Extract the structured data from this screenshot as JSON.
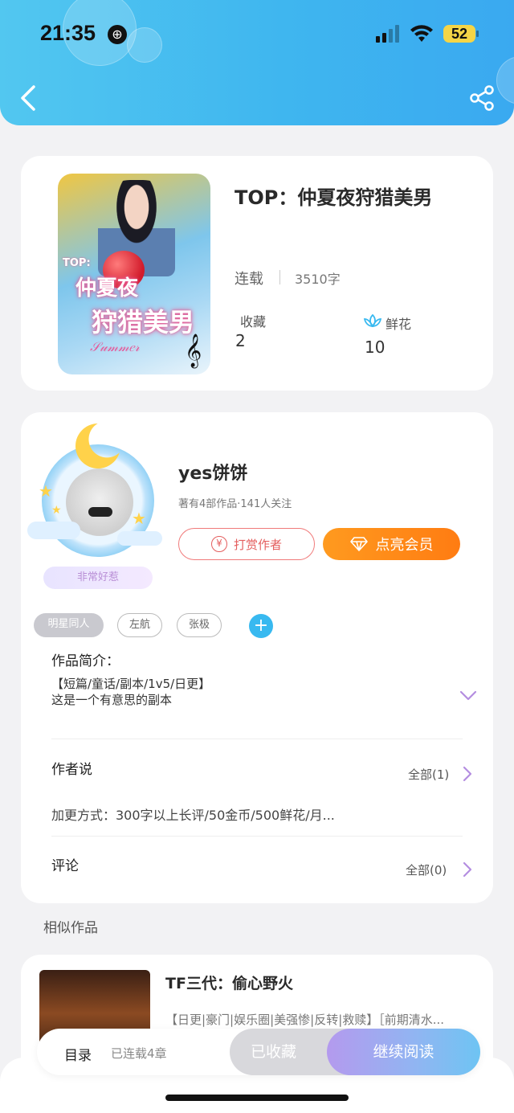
{
  "status_bar": {
    "time": "21:35",
    "battery": "52"
  },
  "book": {
    "title": "TOP：仲夏夜狩猎美男",
    "status": "连载",
    "word_count": "3510字",
    "favorites_label": "收藏",
    "favorites_value": "2",
    "flowers_label": "鲜花",
    "flowers_value": "10",
    "cover_line1": "TOP:",
    "cover_line2": "仲夏夜",
    "cover_line3": "狩猎美男"
  },
  "author": {
    "name": "yes饼饼",
    "meta": "著有4部作品·141人关注",
    "badge": "非常好惹",
    "tip_label": "打赏作者",
    "vip_label": "点亮会员"
  },
  "tags": [
    "明星同人",
    "左航",
    "张极"
  ],
  "intro": {
    "title": "作品简介：",
    "line1": "【短篇/童话/副本/1v5/日更】",
    "line2": "这是一个有意思的副本"
  },
  "author_says": {
    "title": "作者说",
    "all_label": "全部(1)",
    "text": "加更方式：300字以上长评/50金币/500鲜花/月..."
  },
  "comments": {
    "title": "评论",
    "all_label": "全部(0)"
  },
  "similar": {
    "section_label": "相似作品",
    "items": [
      {
        "title": "TF三代：偷心野火",
        "tags": "【日更|豪门|娱乐圈|美强惨|反转|救赎】［前期清水..."
      }
    ]
  },
  "bottom_bar": {
    "toc_label": "目录",
    "toc_count": "已连载4章",
    "collected_label": "已收藏",
    "read_label": "继续阅读"
  },
  "colors": {
    "header_gradient_start": "#52c7f0",
    "header_gradient_end": "#3aa9f0",
    "vip_orange": "#ff8a18",
    "tip_red": "#e45e5e",
    "accent_blue": "#38b9f0",
    "chevron_purple": "#b48de0"
  },
  "icons": {
    "back": "chevron-left-icon",
    "share": "share-icon",
    "flower": "lotus-icon",
    "tip": "yen-coin-icon",
    "vip": "diamond-icon",
    "add_tag": "plus-icon",
    "expand": "chevron-down-icon",
    "more": "chevron-right-icon"
  }
}
